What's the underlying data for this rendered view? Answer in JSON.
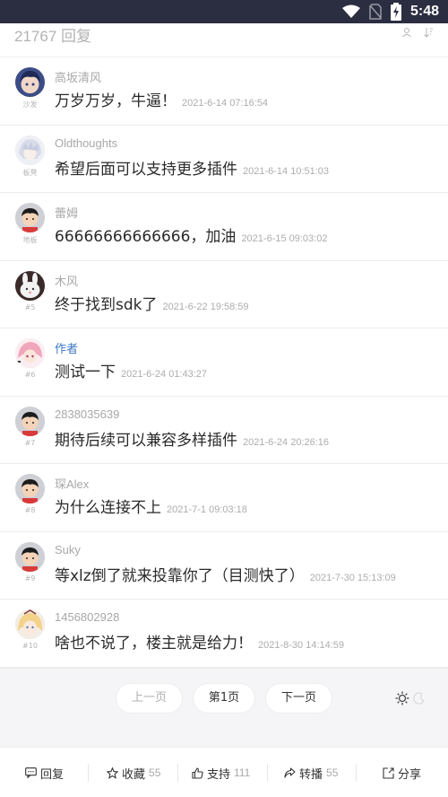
{
  "status_bar": {
    "time": "5:48"
  },
  "header": {
    "reply_count": "21767 回复",
    "icons": [
      "person-icon",
      "sort-icon"
    ]
  },
  "replies": [
    {
      "floor": "沙发",
      "author": "高坂清风",
      "content": "万岁万岁，牛逼！",
      "time": "2021-6-14 07:16:54",
      "avatar": "anime-boy",
      "is_op": false
    },
    {
      "floor": "板凳",
      "author": "Oldthoughts",
      "content": "希望后面可以支持更多插件",
      "time": "2021-6-14 10:51:03",
      "avatar": "anime-white",
      "is_op": false
    },
    {
      "floor": "地板",
      "author": "蕾姆",
      "content": "66666666666666，加油",
      "time": "2021-6-15 09:03:02",
      "avatar": "default",
      "is_op": false
    },
    {
      "floor": "#5",
      "author": "木风",
      "content": "终于找到sdk了",
      "time": "2021-6-22 19:58:59",
      "avatar": "rabbit",
      "is_op": false
    },
    {
      "floor": "#6",
      "author": "作者",
      "content": "测试一下",
      "time": "2021-6-24 01:43:27",
      "avatar": "anime-pink",
      "is_op": true
    },
    {
      "floor": "#7",
      "author": "2838035639",
      "content": "期待后续可以兼容多样插件",
      "time": "2021-6-24 20:26:16",
      "avatar": "default",
      "is_op": false
    },
    {
      "floor": "#8",
      "author": "琛Alex",
      "content": "为什么连接不上",
      "time": "2021-7-1 09:03:18",
      "avatar": "default",
      "is_op": false
    },
    {
      "floor": "#9",
      "author": "Suky",
      "content": "等xlz倒了就来投靠你了（目测快了）",
      "time": "2021-7-30 15:13:09",
      "avatar": "default",
      "is_op": false
    },
    {
      "floor": "#10",
      "author": "1456802928",
      "content": "啥也不说了，楼主就是给力！",
      "time": "2021-8-30 14:14:59",
      "avatar": "anime-blonde",
      "is_op": false
    }
  ],
  "pager": {
    "prev": "上一页",
    "current": "第1页",
    "next": "下一页"
  },
  "bottom_bar": {
    "reply": {
      "label": "回复",
      "icon": "comment-icon"
    },
    "favorite": {
      "label": "收藏",
      "count": "55",
      "icon": "star-icon"
    },
    "support": {
      "label": "支持",
      "count": "111",
      "icon": "thumbs-up-icon"
    },
    "forward": {
      "label": "转播",
      "count": "55",
      "icon": "forward-icon"
    },
    "share": {
      "label": "分享",
      "icon": "share-icon"
    }
  },
  "colors": {
    "status_bar": "#2b2d40",
    "op_author": "#3a76c4",
    "pager_bg": "#f5f5f7"
  }
}
